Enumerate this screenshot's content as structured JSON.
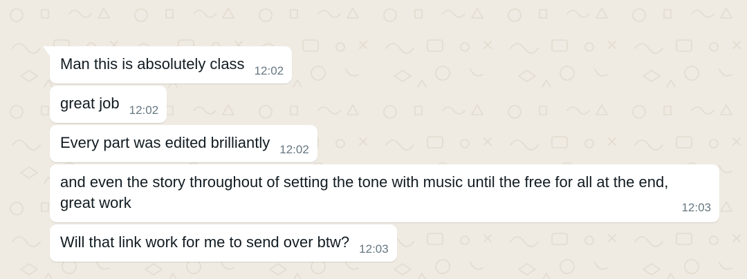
{
  "chat": {
    "messages": [
      {
        "text": "Man this is absolutely class",
        "time": "12:02"
      },
      {
        "text": "great job",
        "time": "12:02"
      },
      {
        "text": "Every part was edited brilliantly",
        "time": "12:02"
      },
      {
        "text": "and even the story throughout of setting the tone with music until the free for all at the end, great work",
        "time": "12:03"
      },
      {
        "text": "Will that link work for me to send over btw?",
        "time": "12:03"
      }
    ]
  },
  "colors": {
    "background": "#efeae2",
    "bubble": "#ffffff",
    "text": "#111b21",
    "timestamp": "#667781"
  }
}
